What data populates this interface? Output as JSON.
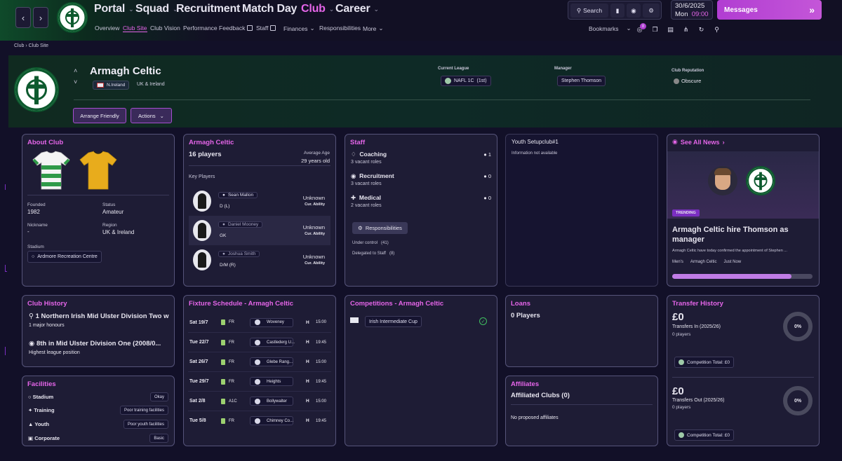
{
  "topbar": {
    "nav": [
      "Portal",
      "Squad",
      "Recruitment",
      "Match Day",
      "Club",
      "Career"
    ],
    "subnav": [
      "Overview",
      "Club Site",
      "Club Vision",
      "Performance Feedback",
      "Staff",
      "Finances",
      "Responsibilities",
      "More"
    ],
    "search_label": "Search",
    "date": "30/6/2025",
    "day": "Mon",
    "time": "09:00",
    "messages_label": "Messages",
    "bookmarks_label": "Bookmarks",
    "notif_count": "8"
  },
  "breadcrumb": {
    "root": "Club",
    "current": "Club Site"
  },
  "club": {
    "name": "Armagh Celtic",
    "nation": "N.Ireland",
    "region": "UK & Ireland",
    "league_label": "Current League",
    "league": "NAFL 1C",
    "league_pos": "(1st)",
    "manager_label": "Manager",
    "manager": "Stephen Thomson",
    "reputation_label": "Club Reputation",
    "reputation": "Obscure",
    "arrange_label": "Arrange Friendly",
    "actions_label": "Actions"
  },
  "about": {
    "title": "About Club",
    "founded_label": "Founded",
    "founded": "1982",
    "status_label": "Status",
    "status": "Amateur",
    "nickname_label": "Nickname",
    "nickname": "-",
    "region_label": "Region",
    "region": "UK & Ireland",
    "stadium_label": "Stadium",
    "stadium": "Ardmore Recreation Centre"
  },
  "squad": {
    "title": "Armagh Celtic",
    "count": "16 players",
    "avg_age_label": "Average Age",
    "avg_age": "29 years old",
    "key_label": "Key Players",
    "players": [
      {
        "name": "Sean Mallon",
        "pos": "D (L)",
        "ability": "Unknown",
        "ability_label": "Cur. Ability"
      },
      {
        "name": "Daniel Mooney",
        "pos": "GK",
        "ability": "Unknown",
        "ability_label": "Cur. Ability"
      },
      {
        "name": "Joshua Smith",
        "pos": "D/M (R)",
        "ability": "Unknown",
        "ability_label": "Cur. Ability"
      }
    ]
  },
  "staff": {
    "title": "Staff",
    "roles": [
      {
        "name": "Coaching",
        "vacant": "3 vacant roles",
        "count": "1"
      },
      {
        "name": "Recruitment",
        "vacant": "3 vacant roles",
        "count": "0"
      },
      {
        "name": "Medical",
        "vacant": "2 vacant roles",
        "count": "0"
      }
    ],
    "resp_label": "Responsibilities",
    "under_control": "Under control",
    "under_control_count": "(41)",
    "delegated": "Delegated to Staff",
    "delegated_count": "(8)"
  },
  "youth": {
    "title": "Youth Setupclub#1",
    "info": "Information not available"
  },
  "news": {
    "title": "See All News",
    "tag": "TRENDING",
    "headline": "Armagh Celtic hire Thomson as manager",
    "snippet": "Armagh Celtic have today confirmed the appointment of Stephen ...",
    "meta": [
      "Men's",
      "Armagh Celtic",
      "Just Now"
    ],
    "progress": 0.85
  },
  "history": {
    "title": "Club History",
    "best": "1 Northern Irish Mid Ulster Division Two w",
    "best_sub": "1  major honours",
    "position": "8th in Mid Ulster Division One (2008/0...",
    "position_sub": "Highest league position"
  },
  "fixtures": {
    "title": "Fixture Schedule - Armagh Celtic",
    "rows": [
      {
        "date": "Sat 19/7",
        "comp": "FR",
        "opp": "Woveney",
        "venue": "H",
        "time": "15:00"
      },
      {
        "date": "Tue 22/7",
        "comp": "FR",
        "opp": "Castlederg U...",
        "venue": "H",
        "time": "19:45"
      },
      {
        "date": "Sat 26/7",
        "comp": "FR",
        "opp": "Glebe Rang...",
        "venue": "H",
        "time": "15:00"
      },
      {
        "date": "Tue 29/7",
        "comp": "FR",
        "opp": "Heights",
        "venue": "H",
        "time": "19:45"
      },
      {
        "date": "Sat 2/8",
        "comp": "A1C",
        "opp": "Bollywalter",
        "venue": "H",
        "time": "15:00"
      },
      {
        "date": "Tue 5/8",
        "comp": "FR",
        "opp": "Chimney Co...",
        "venue": "H",
        "time": "19:45"
      }
    ]
  },
  "competitions": {
    "title": "Competitions - Armagh Celtic",
    "items": [
      "Irish Intermediate Cup"
    ]
  },
  "loans": {
    "title": "Loans",
    "count": "0 Players"
  },
  "affiliates": {
    "title": "Affiliates",
    "heading": "Affiliated Clubs (0)",
    "empty": "No proposed affiliates"
  },
  "transfers": {
    "title": "Transfer History",
    "in_amount": "£0",
    "in_label": "Transfers In (2025/26)",
    "in_players": "0 players",
    "in_pct": "0%",
    "in_total": "Competition Total:  £0",
    "out_amount": "£0",
    "out_label": "Transfers Out (2025/26)",
    "out_players": "0 players",
    "out_pct": "0%",
    "out_total": "Competition Total:  £0"
  },
  "facilities": {
    "title": "Facilities",
    "items": [
      {
        "name": "Stadium",
        "value": "Okay"
      },
      {
        "name": "Training",
        "value": "Poor training facilities"
      },
      {
        "name": "Youth",
        "value": "Poor youth facilities"
      },
      {
        "name": "Corporate",
        "value": "Basic"
      }
    ]
  },
  "colors": {
    "accent": "#e565e9",
    "panel": "#1e1c35",
    "border": "#56547a",
    "hero": "#0e2a26"
  }
}
